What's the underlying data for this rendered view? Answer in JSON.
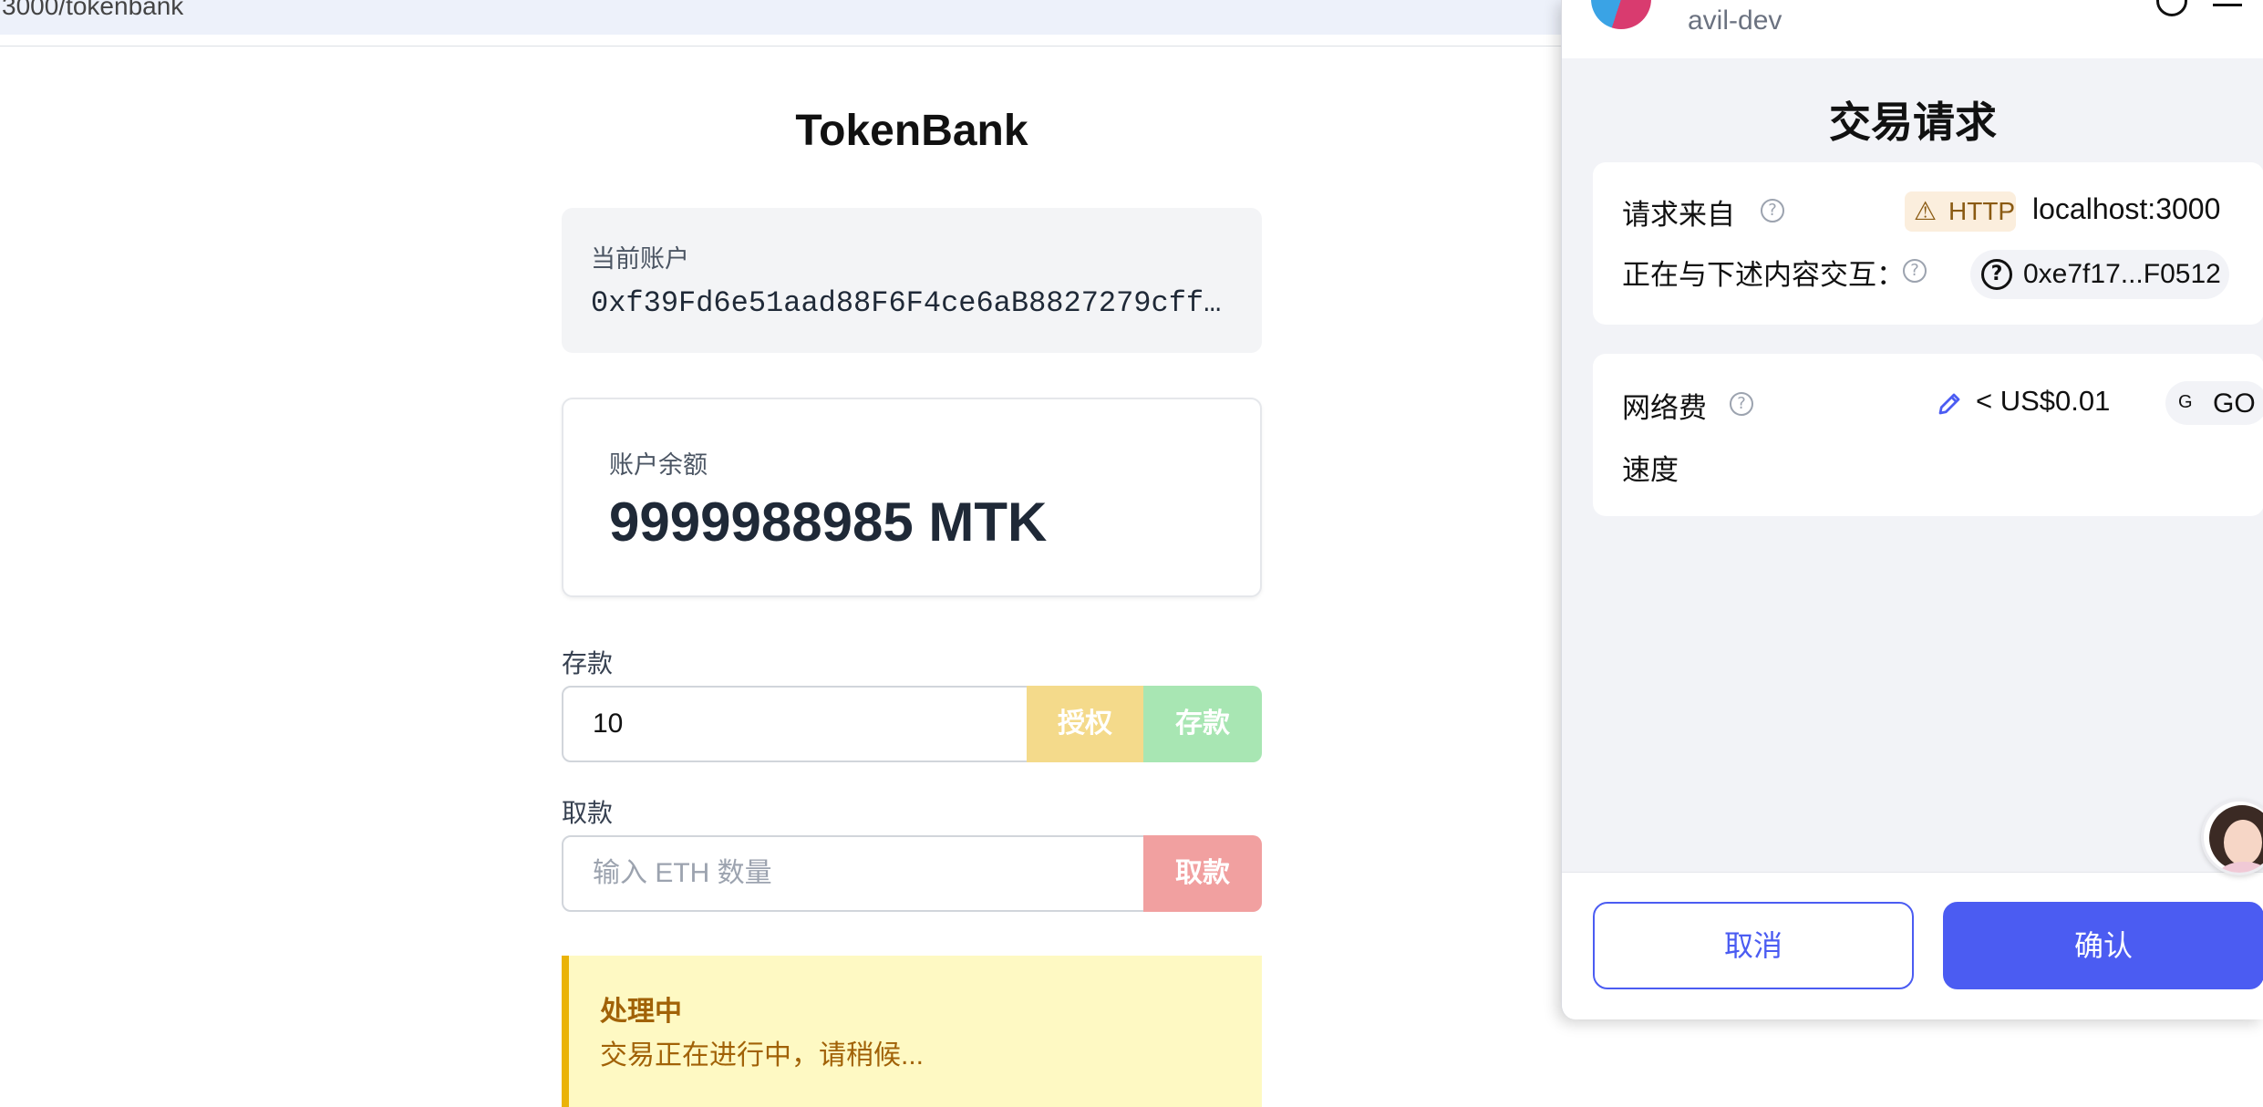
{
  "browser": {
    "url_fragment": "3000/tokenbank"
  },
  "app": {
    "title": "TokenBank",
    "account": {
      "label": "当前账户",
      "address": "0xf39Fd6e51aad88F6F4ce6aB8827279cff…"
    },
    "balance": {
      "label": "账户余额",
      "value": "9999988985 MTK"
    },
    "deposit": {
      "label": "存款",
      "input_value": "10",
      "approve_label": "授权",
      "deposit_label": "存款"
    },
    "withdraw": {
      "label": "取款",
      "placeholder": "输入 ETH 数量",
      "withdraw_label": "取款"
    },
    "status": {
      "title": "处理中",
      "message": "交易正在进行中，请稍候..."
    },
    "colors": {
      "approve": "#f4da8b",
      "deposit": "#a8e6b3",
      "withdraw": "#f1a0a0",
      "status_bg": "#fef9c3",
      "status_accent": "#eab308"
    }
  },
  "wallet": {
    "network": "avil-dev",
    "title": "交易请求",
    "request": {
      "from_label": "请求来自",
      "protocol_badge": "HTTP",
      "origin": "localhost:3000",
      "interacting_label": "正在与下述内容交互：",
      "contract_address": "0xe7f17...F0512"
    },
    "fee": {
      "network_fee_label": "网络费",
      "fee_value": "< US$0.01",
      "speed_badge_letter": "G",
      "speed_badge_text": "GO",
      "speed_label": "速度"
    },
    "buttons": {
      "cancel": "取消",
      "confirm": "确认"
    },
    "icons": {
      "header_info": "info-icon",
      "header_menu": "menu-icon",
      "help": "help-icon",
      "warning": "warning-icon",
      "edit": "pencil-icon"
    },
    "colors": {
      "primary": "#4b5cf2",
      "panel_bg": "#f2f3f7",
      "http_badge_bg": "#fbeedd",
      "http_badge_fg": "#8a5a12"
    }
  }
}
